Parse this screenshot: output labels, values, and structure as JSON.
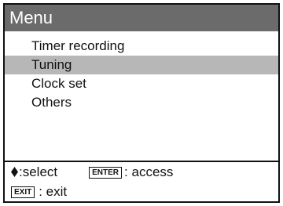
{
  "menu": {
    "title": "Menu",
    "items": [
      {
        "label": "Timer recording",
        "selected": false
      },
      {
        "label": "Tuning",
        "selected": true
      },
      {
        "label": "Clock set",
        "selected": false
      },
      {
        "label": "Others",
        "selected": false
      }
    ]
  },
  "footer": {
    "select_icon": "up-down-diamond-icon",
    "select_text": ":select",
    "enter_key": "ENTER",
    "access_text": ": access",
    "exit_key": "EXIT",
    "exit_text": ": exit"
  },
  "colors": {
    "titlebar_bg": "#6b6b6b",
    "selected_bg": "#b7b7b7",
    "border": "#111111"
  }
}
